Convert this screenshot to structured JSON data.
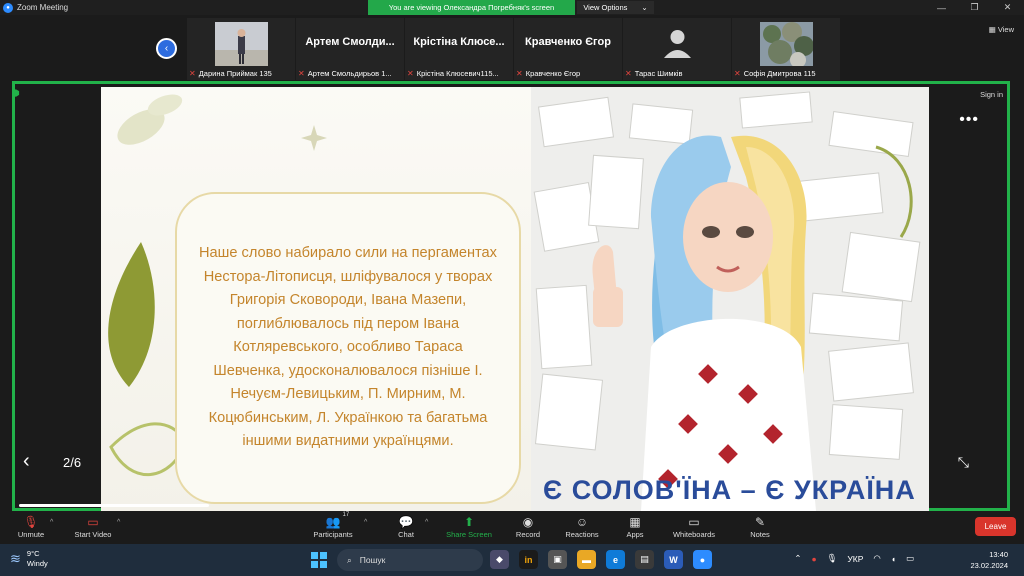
{
  "titlebar": {
    "app_title": "Zoom Meeting",
    "viewing_banner": "You are viewing Олександра Погребняк's screen",
    "view_options": "View Options"
  },
  "gallery": {
    "view_label": "View",
    "tiles": [
      {
        "big": "",
        "name": "Дарина Приймак 135"
      },
      {
        "big": "Артем  Смолди...",
        "name": "Артем Смольдирьов 1..."
      },
      {
        "big": "Крістіна  Клюсе...",
        "name": "Крістіна Клюсевич115..."
      },
      {
        "big": "Кравченко Єгор",
        "name": "Кравченко Єгор"
      },
      {
        "big": "",
        "name": "Тарас Шимків"
      },
      {
        "big": "",
        "name": "Софія Дмитрова 115"
      }
    ]
  },
  "share": {
    "sign_in": "Sign in",
    "page_indicator": "2/6",
    "slide_text": "Наше слово набирало сили на пергаментах Нестора-Літописця, шліфувалося у творах Григорія Сковороди, Івана Мазепи, поглиблювалось під пером Івана Котляревського, особливо Тараса Шевченка, удосконалювалося пізніше І. Нечуєм-Левицьким, П. Мирним, М. Коцюбинським, Л. Українкою та багатьма іншими видатними українцями.",
    "banner": "Є СОЛОВ'ЇНА – Є УКРАЇНА"
  },
  "toolbar": {
    "unmute": "Unmute",
    "start_video": "Start Video",
    "participants": "Participants",
    "participants_count": "17",
    "chat": "Chat",
    "share_screen": "Share Screen",
    "record": "Record",
    "reactions": "Reactions",
    "apps": "Apps",
    "whiteboards": "Whiteboards",
    "notes": "Notes",
    "leave": "Leave"
  },
  "taskbar": {
    "temp": "9°C",
    "weather": "Windy",
    "search_placeholder": "Пошук",
    "lang": "УКР",
    "time": "13:40",
    "date": "23.02.2024"
  },
  "colors": {
    "share_border": "#22b24a",
    "leave": "#d9352c",
    "slide_text": "#c4852c",
    "banner": "#2a4c9a"
  }
}
